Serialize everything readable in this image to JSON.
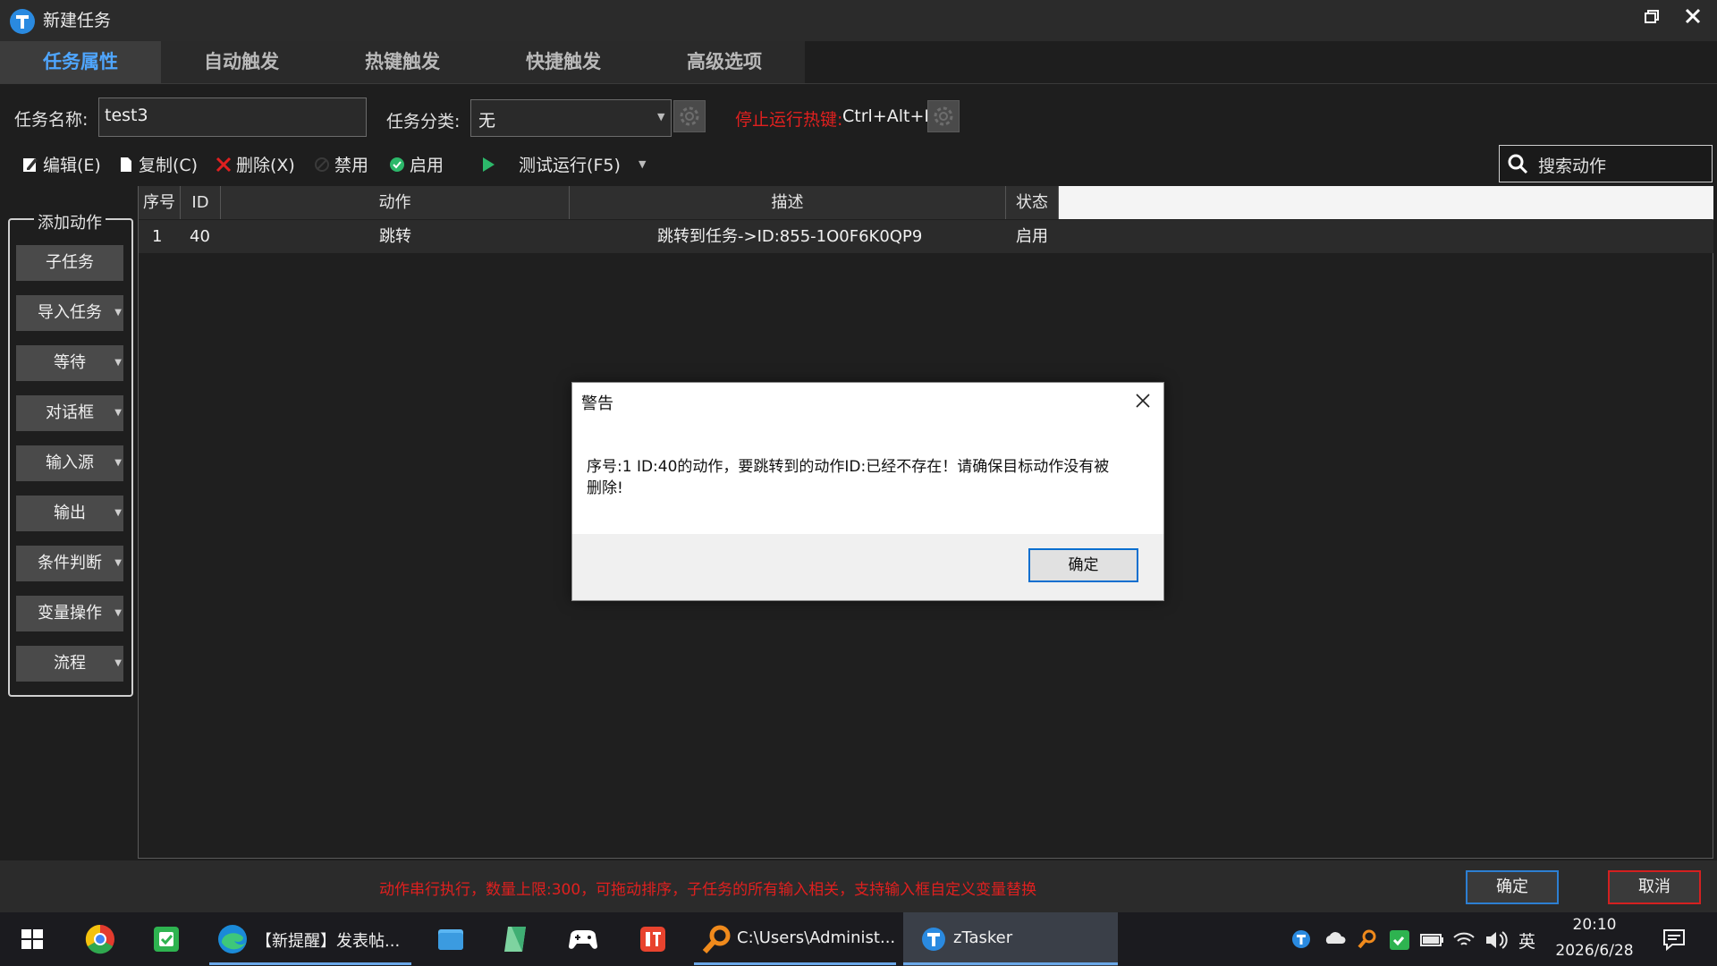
{
  "window": {
    "title": "新建任务"
  },
  "tabs": [
    "任务属性",
    "自动触发",
    "热键触发",
    "快捷触发",
    "高级选项"
  ],
  "form": {
    "name_label": "任务名称:",
    "name_value": "test3",
    "category_label": "任务分类:",
    "category_value": "无",
    "hotkey_label": "停止运行热键:",
    "hotkey_value": "Ctrl+Alt+P"
  },
  "toolbar": {
    "edit": "编辑(E)",
    "copy": "复制(C)",
    "delete": "删除(X)",
    "disable": "禁用",
    "enable": "启用",
    "test_run": "测试运行(F5)",
    "search_placeholder": "搜索动作"
  },
  "action_panel": {
    "title": "添加动作",
    "buttons": [
      "子任务",
      "导入任务",
      "等待",
      "对话框",
      "输入源",
      "输出",
      "条件判断",
      "变量操作",
      "流程"
    ]
  },
  "table": {
    "headers": [
      "序号",
      "ID",
      "动作",
      "描述",
      "状态"
    ],
    "rows": [
      {
        "seq": "1",
        "id": "40",
        "action": "跳转",
        "description": "跳转到任务->ID:855-1O0F6K0QP9",
        "status": "启用"
      }
    ]
  },
  "dialog": {
    "title": "警告",
    "message": "序号:1 ID:40的动作，要跳转到的动作ID:已经不存在！请确保目标动作没有被删除!",
    "ok": "确定"
  },
  "bottom": {
    "message": "动作串行执行，数量上限:300，可拖动排序，子任务的所有输入相关，支持输入框自定义变量替换",
    "ok": "确定",
    "cancel": "取消"
  },
  "taskbar": {
    "items": [
      "【新提醒】发表帖...",
      "C:\\Users\\Administ...",
      "zTasker"
    ],
    "ime": "英",
    "time": "20:10",
    "date": "2026/6/28"
  },
  "colors": {
    "accent": "#4fa6ff",
    "warning_red": "#e0201f",
    "dialog_border": "#0b6fcf"
  }
}
